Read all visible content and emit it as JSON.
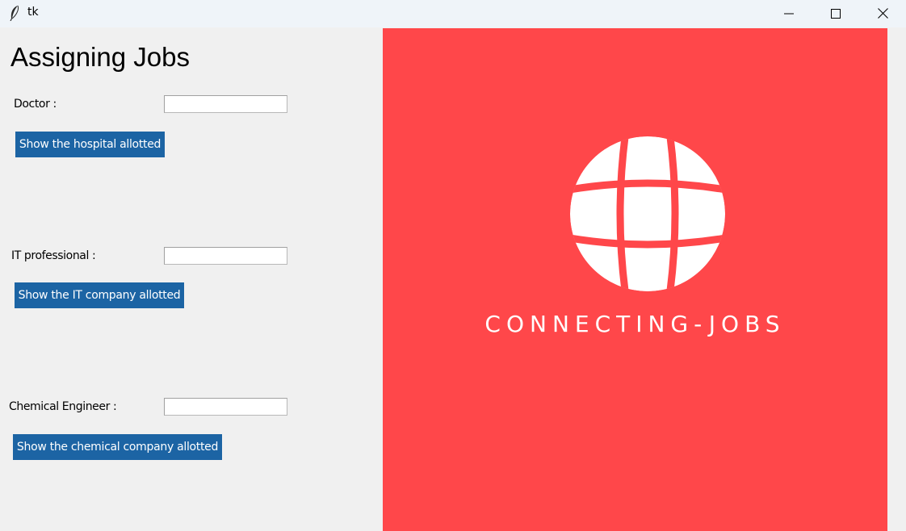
{
  "window": {
    "title": "tk",
    "controls": [
      "minimize-icon",
      "maximize-icon",
      "close-icon"
    ]
  },
  "form": {
    "heading": "Assigning Jobs",
    "doctor": {
      "label": "Doctor :",
      "value": "",
      "button_label": "Show the hospital allotted"
    },
    "it": {
      "label": "IT professional :",
      "value": "",
      "button_label": "Show the IT company allotted"
    },
    "chemical": {
      "label": "Chemical Engineer :",
      "value": "",
      "button_label": "Show the chemical company allotted"
    }
  },
  "logo": {
    "icon": "globe-icon",
    "text": "CONNECTING-JOBS"
  },
  "colors": {
    "button": "#1c64a4",
    "logo_background": "#ff474a",
    "window_background": "#f0f0f0"
  }
}
